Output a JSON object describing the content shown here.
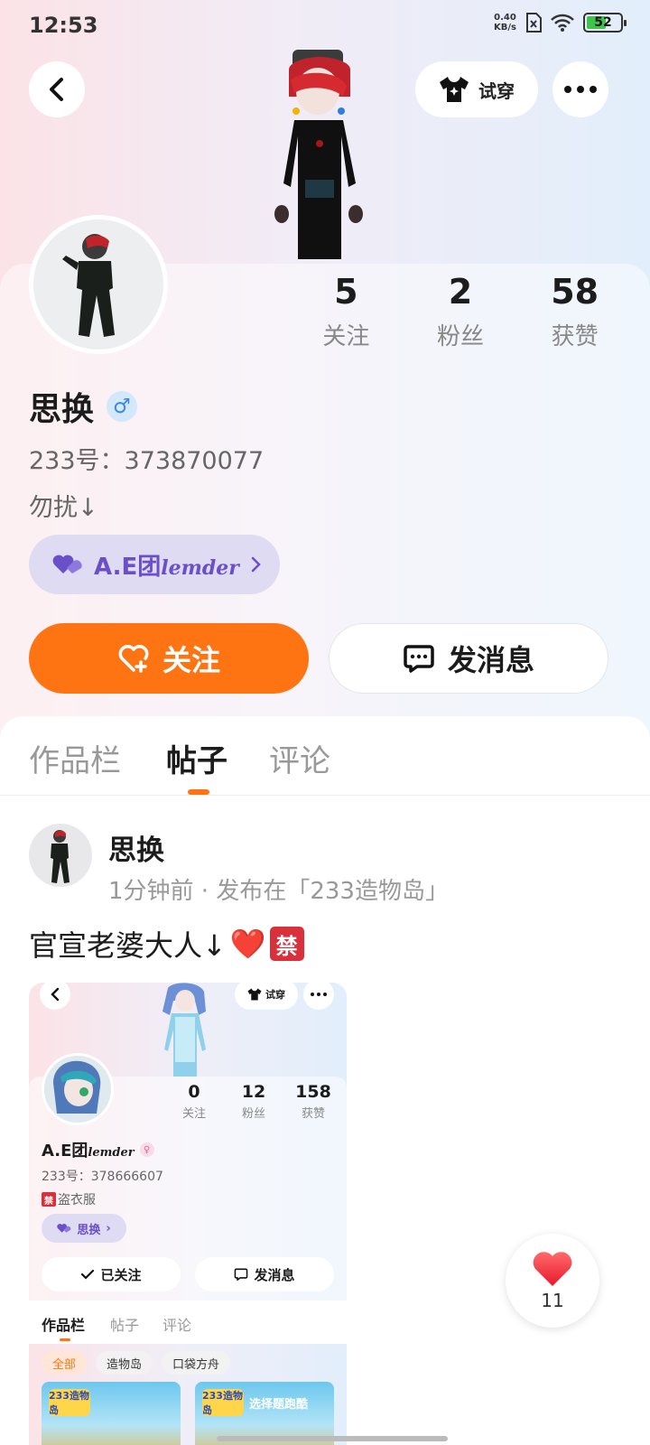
{
  "status_bar": {
    "time": "12:53",
    "net_speed_value": "0.40",
    "net_speed_unit": "KB/s",
    "battery_level": "52"
  },
  "header": {
    "tryon_label": "试穿"
  },
  "profile": {
    "name": "思换",
    "gender_symbol": "♂",
    "uid": "233号：373870077",
    "bio": "勿扰↓",
    "group_name": "A.E团",
    "group_script": "lemder",
    "stats": [
      {
        "value": "5",
        "label": "关注"
      },
      {
        "value": "2",
        "label": "粉丝"
      },
      {
        "value": "58",
        "label": "获赞"
      }
    ],
    "follow_label": "关注",
    "message_label": "发消息"
  },
  "tabs": [
    {
      "label": "作品栏",
      "active": false
    },
    {
      "label": "帖子",
      "active": true
    },
    {
      "label": "评论",
      "active": false
    }
  ],
  "post": {
    "author": "思换",
    "meta": "1分钟前 · 发布在「233造物岛」",
    "text": "官宣老婆大人↓",
    "heart_emoji": "❤️",
    "ban_glyph": "禁"
  },
  "embedded": {
    "tryon_label": "试穿",
    "stats": [
      {
        "value": "0",
        "label": "关注"
      },
      {
        "value": "12",
        "label": "粉丝"
      },
      {
        "value": "158",
        "label": "获赞"
      }
    ],
    "name": "A.E团",
    "name_script": "lemder",
    "gender_symbol": "♀",
    "uid": "233号：378666607",
    "bio_ban": "禁",
    "bio": "盗衣服",
    "group_name": "思换",
    "followed_label": "已关注",
    "message_label": "发消息",
    "tabs": [
      "作品栏",
      "帖子",
      "评论"
    ],
    "chips": [
      "全部",
      "造物岛",
      "口袋方舟"
    ],
    "thumb_logo": "233造物岛",
    "thumb_caption": "选择题跑酷"
  },
  "like": {
    "count": "11"
  },
  "colors": {
    "accent": "#ff7412",
    "group_purple": "#6a4fc8",
    "pill_bg": "#dedbf3",
    "heart": "#f2353d"
  }
}
